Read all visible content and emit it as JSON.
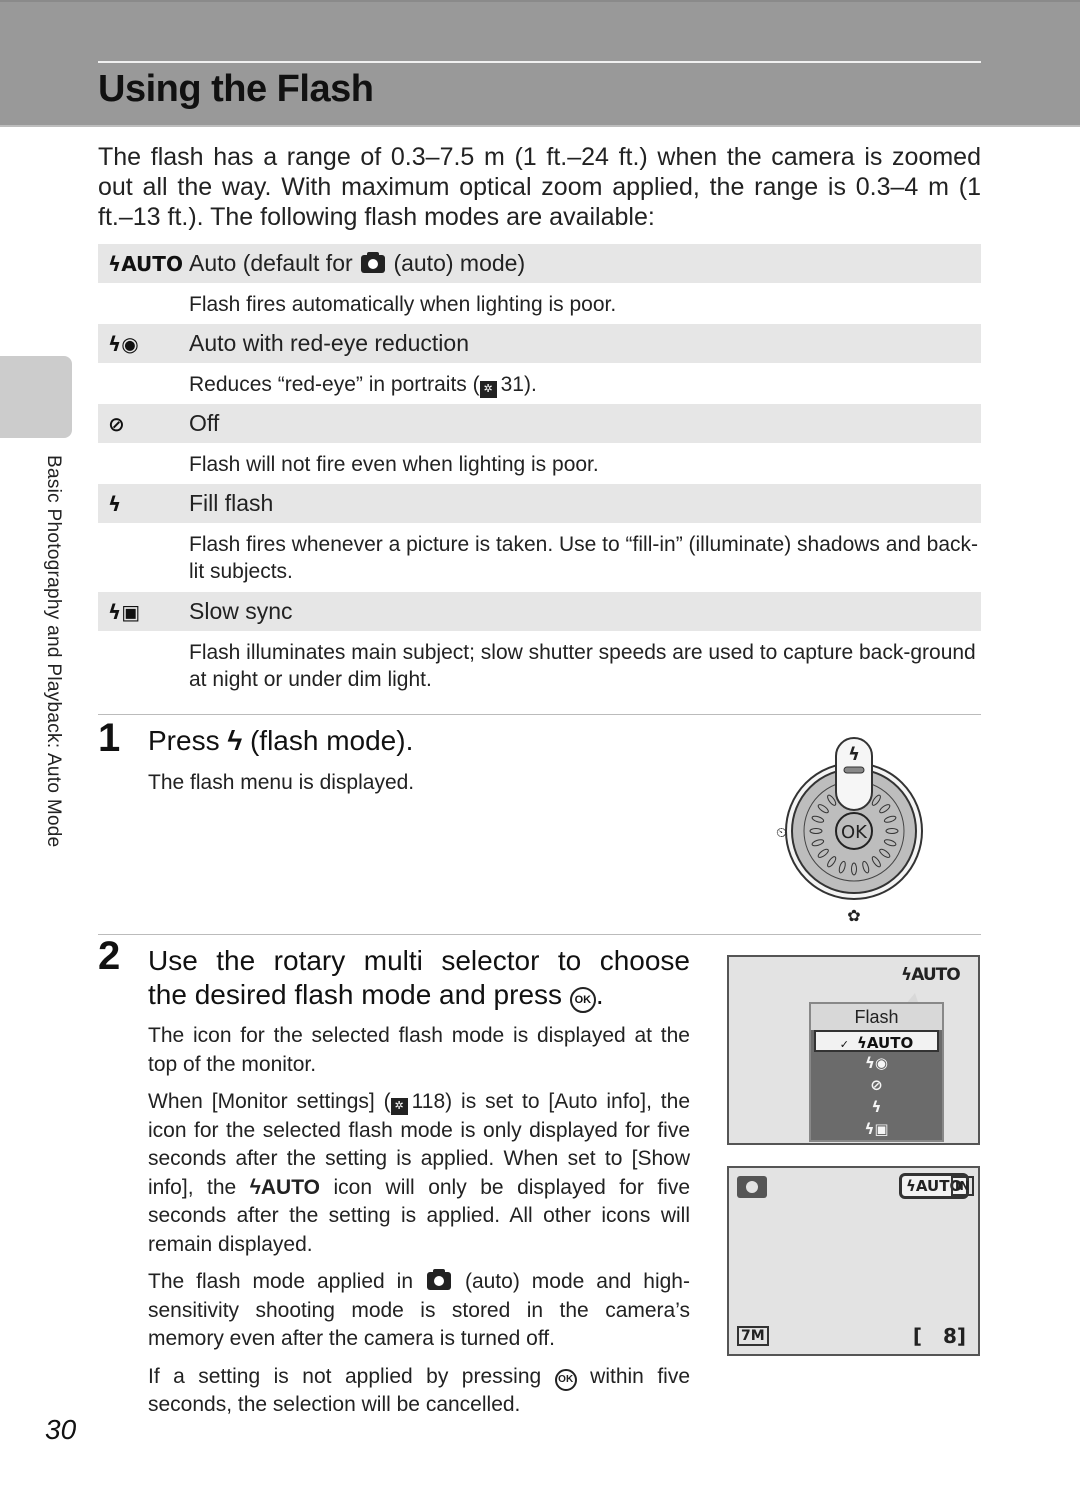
{
  "header": {
    "title": "Using the Flash"
  },
  "intro": "The flash has a range of 0.3–7.5 m (1 ft.–24 ft.) when the camera is zoomed out all the way. With maximum optical zoom applied, the range is 0.3–4 m (1 ft.–13 ft.). The following flash modes are available:",
  "modes": [
    {
      "icon": "ϟAUTO",
      "icon_name": "flash-auto-icon",
      "name_before": "Auto (default for",
      "name_after": "(auto) mode)",
      "desc": "Flash fires automatically when lighting is poor."
    },
    {
      "icon": "ϟ◉",
      "icon_name": "flash-red-eye-icon",
      "name": "Auto with red-eye reduction",
      "desc_before": "Reduces “red-eye” in portraits (",
      "desc_ref": "31",
      "desc_after": ")."
    },
    {
      "icon": "⊘",
      "icon_name": "flash-off-icon",
      "name": "Off",
      "desc": "Flash will not fire even when lighting is poor."
    },
    {
      "icon": "ϟ",
      "icon_name": "fill-flash-icon",
      "name": "Fill flash",
      "desc": "Flash fires whenever a picture is taken. Use to “fill-in” (illuminate) shadows and back-lit subjects."
    },
    {
      "icon": "ϟ▣",
      "icon_name": "slow-sync-icon",
      "name": "Slow sync",
      "desc": "Flash illuminates main subject; slow shutter speeds are used to capture back-ground at night or under dim light."
    }
  ],
  "steps": [
    {
      "number": "1",
      "title_before": "Press",
      "title_icon": "ϟ",
      "title_after": "(flash mode).",
      "body": "The flash menu is displayed."
    },
    {
      "number": "2",
      "title_line1": "Use the rotary multi selector to choose",
      "title_line2": "the desired flash mode and press",
      "title_ok": "OK",
      "p1": "The icon for the selected flash mode is displayed at the top of the monitor.",
      "p2_before": "When [Monitor settings] (",
      "p2_ref": "118",
      "p2_mid": ") is set to [Auto info], the icon for the selected flash mode is only displayed for five seconds after the setting is applied. When set to [Show info], the",
      "p2_icon": "ϟAUTO",
      "p2_after": "icon will only be displayed for five seconds after the setting is applied. All other icons will remain displayed.",
      "p3_before": "The flash mode applied in",
      "p3_after": "(auto) mode and high-sensitivity shooting mode is stored in the camera’s memory even after the camera is turned off.",
      "p4_before": "If a setting is not applied by pressing",
      "p4_ok": "OK",
      "p4_after": "within five seconds, the selection will be cancelled."
    }
  ],
  "dial": {
    "center_label": "OK",
    "top_icon": "ϟ",
    "left_icon": "⏲",
    "bottom_icon": "✿"
  },
  "screen1": {
    "top_icon": "ϟAUTO",
    "menu_title": "Flash",
    "menu_items": [
      "ϟAUTO",
      "ϟ◉",
      "⊘",
      "ϟ",
      "ϟ▣"
    ],
    "selected_index": 0,
    "check": "✓"
  },
  "screen2": {
    "flash_icon": "ϟAUTO",
    "memory_icon": "IN",
    "image_size": "7M",
    "exposures": "8"
  },
  "side_label": "Basic Photography and Playback: Auto Mode",
  "page_number": "30"
}
